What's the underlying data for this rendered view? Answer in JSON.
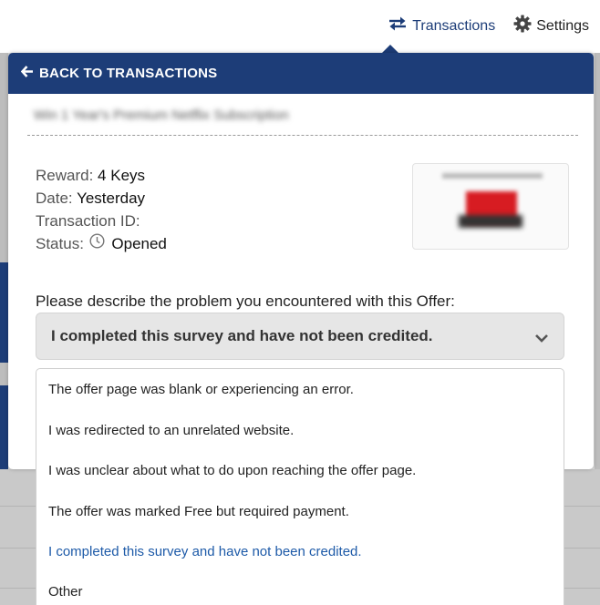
{
  "nav": {
    "transactions_label": "Transactions",
    "settings_label": "Settings"
  },
  "panel": {
    "back_label": "BACK TO TRANSACTIONS",
    "offer_title": "Win 1 Year's Premium Netflix Subscription",
    "details": {
      "reward_label": "Reward:",
      "reward_value": "4 Keys",
      "date_label": "Date:",
      "date_value": "Yesterday",
      "transaction_id_label": "Transaction ID:",
      "transaction_id_value": "",
      "status_label": "Status:",
      "status_value": "Opened"
    },
    "question": "Please describe the problem you encountered with this Offer:",
    "selected_problem": "I completed this survey and have not been credited.",
    "options": [
      "The offer page was blank or experiencing an error.",
      "I was redirected to an unrelated website.",
      "I was unclear about what to do upon reaching the offer page.",
      "The offer was marked Free but required payment.",
      "I completed this survey and have not been credited.",
      "Other"
    ],
    "selected_index": 4
  },
  "colors": {
    "brand_navy": "#1d3d78",
    "selected_option": "#1d5aa8"
  },
  "icons": {
    "transactions": "swap-arrows-icon",
    "settings": "gear-icon",
    "back": "arrow-left-icon",
    "status": "clock-icon",
    "select": "chevron-down-icon"
  }
}
